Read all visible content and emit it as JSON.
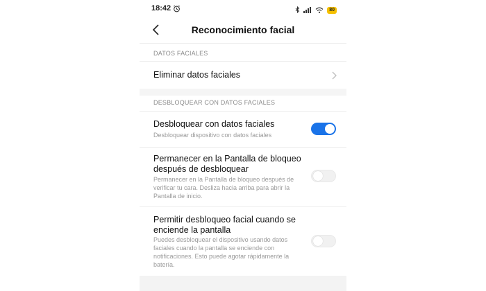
{
  "status_bar": {
    "time": "18:42",
    "battery": "80",
    "icons": [
      "alarm-icon",
      "bluetooth-icon",
      "signal-icon",
      "wifi-icon",
      "battery-icon"
    ]
  },
  "header": {
    "title": "Reconocimiento facial",
    "back_icon": "back-arrow-icon"
  },
  "sections": {
    "face_data": {
      "label": "DATOS FACIALES",
      "delete_item": "Eliminar datos faciales"
    },
    "unlock": {
      "label": "DESBLOQUEAR CON DATOS FACIALES",
      "items": [
        {
          "title": "Desbloquear con datos faciales",
          "subtitle": "Desbloquear dispositivo con datos faciales",
          "enabled": true
        },
        {
          "title": "Permanecer en la Pantalla de bloqueo después de desbloquear",
          "subtitle": "Permanecer en la Pantalla de bloqueo después de verificar tu cara. Desliza hacia arriba para abrir la Pantalla de inicio.",
          "enabled": false
        },
        {
          "title": "Permitir desbloqueo facial cuando se enciende la pantalla",
          "subtitle": "Puedes desbloquear el dispositivo usando datos faciales cuando la pantalla se enciende con notificaciones. Esto puede agotar rápidamente la batería.",
          "enabled": false
        }
      ]
    }
  },
  "colors": {
    "accent": "#1a73e8",
    "battery": "#f5c000"
  }
}
